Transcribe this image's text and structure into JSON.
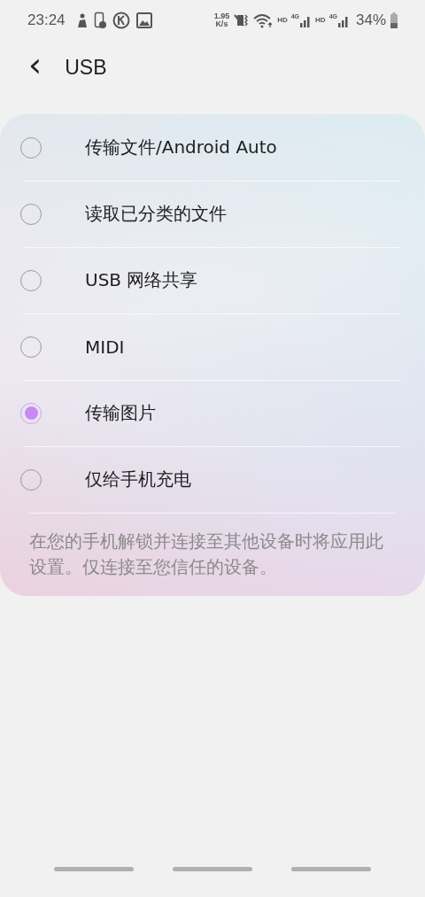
{
  "status_bar": {
    "time": "23:24",
    "net_speed_value": "1.95",
    "net_speed_unit": "K/s",
    "sims": [
      {
        "hd": "HD",
        "network": "4G"
      },
      {
        "hd": "HD",
        "network": "4G"
      }
    ],
    "battery": "34%"
  },
  "header": {
    "back": "‹",
    "title": "USB"
  },
  "options": [
    {
      "label": "传输文件/Android Auto",
      "selected": false
    },
    {
      "label": "读取已分类的文件",
      "selected": false
    },
    {
      "label": "USB 网络共享",
      "selected": false
    },
    {
      "label": "MIDI",
      "selected": false
    },
    {
      "label": "传输图片",
      "selected": true
    },
    {
      "label": "仅给手机充电",
      "selected": false
    }
  ],
  "note": "在您的手机解锁并连接至其他设备时将应用此设置。仅连接至您信任的设备。"
}
